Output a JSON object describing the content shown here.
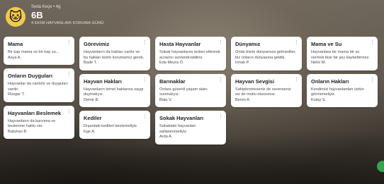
{
  "header": {
    "avatar_emoji": "🐱",
    "author": "Seda Keçe • 4g",
    "title": "6B",
    "subtitle": "4 EKİM HAYVANLARI KORUMA GÜNÜ"
  },
  "columns": [
    [
      {
        "title": "Mama",
        "body": "Bir kap mama ve bir kap su...",
        "author": "Asya A."
      },
      {
        "title": "Onların Duyguları",
        "body": "Hayvanlar da canlıdır ve duyguları vardır.",
        "author": "Rüzgar T."
      },
      {
        "title": "Hayvanları Beslemek",
        "body": "Hayvanların da barınma ve beslenme hakkı var.",
        "author": "Batuhan B."
      }
    ],
    [
      {
        "title": "Görevimiz",
        "body": "Hayvanların da hakları vardır ve bu hakları bizim korumamız gerek.",
        "author": "Bade T."
      },
      {
        "title": "Hayvan Hakları",
        "body": "Hayvanların temel haklarına saygı duymalıyız.",
        "author": "Demir B."
      },
      {
        "title": "Kediler",
        "body": "Dışardaki kedileri beslemeliyiz.",
        "author": "Ege A."
      }
    ],
    [
      {
        "title": "Hasta Hayvanlar",
        "body": "Sokak hayvanlarını tedavi ettirerek acılarını sonlandırabiliriz.",
        "author": "Eda Meyra Ö."
      },
      {
        "title": "Barınaklar",
        "body": "Onlara güvenli yaşam alanı sunmalıyız.",
        "author": "Batu V."
      },
      {
        "title": "Sokak Hayvanları",
        "body": "Sokaktaki hayvanları sahiplenmeliyiz.",
        "author": "Arda A."
      }
    ],
    [
      {
        "title": "Dünyamız",
        "body": "Onlar bizim dünyamıza gelmediler, biz onların dünyasına geldik.",
        "author": "Irmak P."
      },
      {
        "title": "Hayvan Sevgisi",
        "body": "Sahiplenmeseniz de severseniz siz de mutlu olursunuz.",
        "author": "Beren A."
      }
    ],
    [
      {
        "title": "Mama ve Su",
        "body": "Hayvanlara bir mama bir su vermek bize bir şey kaybettirmez.",
        "author": "Nehir M."
      },
      {
        "title": "Onların Hakları",
        "body": "Kendimizi hayvanlardan üstün görmemeliyiz.",
        "author": "Kutay Ş."
      }
    ]
  ],
  "icons": {
    "menu": "more-vertical-icon",
    "add": "add-fab"
  },
  "colors": {
    "avatar": "#f2c94c",
    "fab": "#2fa84f"
  }
}
